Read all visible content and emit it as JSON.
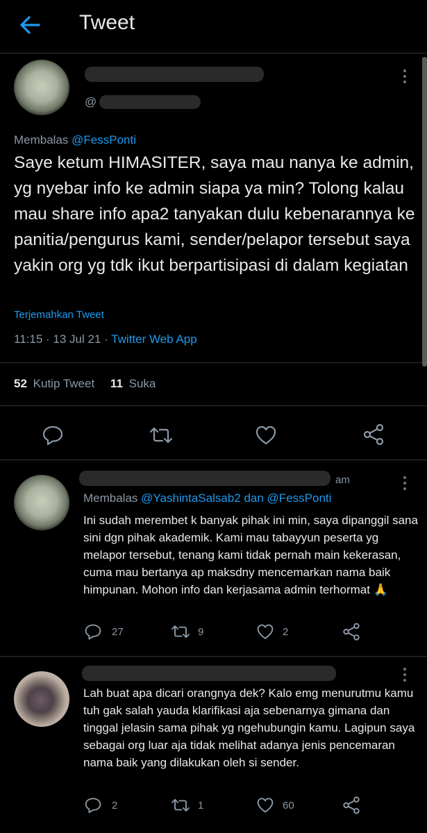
{
  "header": {
    "title": "Tweet"
  },
  "main_tweet": {
    "handle_prefix": "@",
    "replying_label": "Membalas",
    "replying_to": "@FessPonti",
    "text": "Saye ketum HIMASITER, saya mau nanya ke admin, yg nyebar info ke admin siapa ya min? Tolong kalau mau share info apa2 tanyakan dulu kebenarannya ke panitia/pengurus kami, sender/pelapor tersebut saya yakin org yg tdk ikut berpartisipasi di dalam kegiatan",
    "translate": "Terjemahkan Tweet",
    "time": "11:15 · 13 Jul 21 ·",
    "source": "Twitter Web App",
    "stats": {
      "quotes_count": "52",
      "quotes_label": "Kutip Tweet",
      "likes_count": "11",
      "likes_label": "Suka"
    }
  },
  "reply1": {
    "time_suffix": "am",
    "replying_label": "Membalas",
    "replying_to": "@YashintaSalsab2 dan @FessPonti",
    "text": "Ini sudah merembet k banyak pihak ini min, saya dipanggil sana sini dgn pihak akademik. Kami mau tabayyun peserta yg melapor tersebut, tenang kami tidak pernah main kekerasan, cuma mau bertanya ap maksdny mencemarkan nama baik himpunan. Mohon info dan kerjasama admin terhormat",
    "emoji": "🙏",
    "reply_count": "27",
    "retweet_count": "9",
    "like_count": "2"
  },
  "reply2": {
    "text": "Lah buat apa dicari orangnya dek? Kalo emg menurutmu kamu tuh gak salah yauda klarifikasi aja sebenarnya gimana dan tinggal jelasin sama pihak yg ngehubungin kamu. Lagipun saya sebagai org luar aja tidak melihat adanya jenis pencemaran nama baik yang dilakukan oleh si sender.",
    "reply_count": "2",
    "retweet_count": "1",
    "like_count": "60"
  },
  "colors": {
    "background": "#000000",
    "link": "#1d9bf0",
    "secondary": "#8b98a5",
    "divider": "#2f3336"
  }
}
